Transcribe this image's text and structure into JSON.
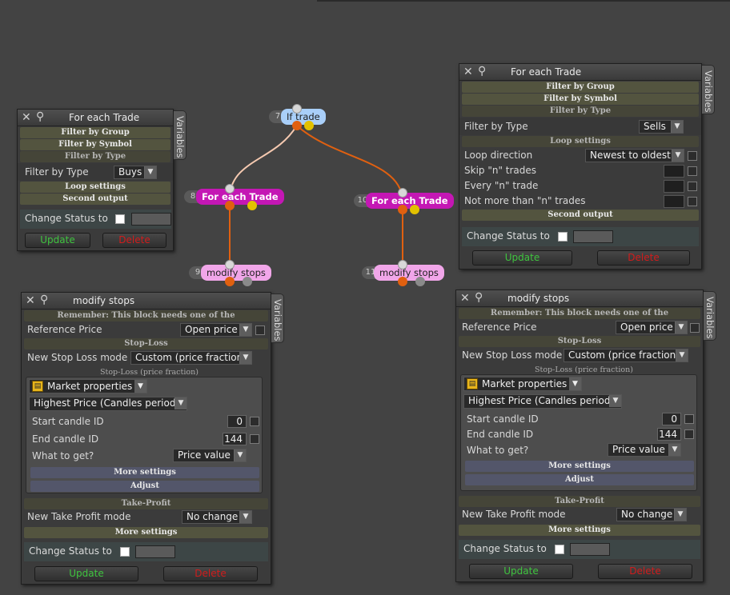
{
  "colors": {
    "background": "#434343",
    "wire_orange": "#e06010",
    "wire_light": "#f5c9b0",
    "node_magenta": "#c417b4",
    "node_pink": "#f1a6e9",
    "node_blue": "#a9cff9",
    "update_green": "#3fc43f",
    "delete_red": "#d11c1c"
  },
  "icons": {
    "close": "close-icon",
    "pin": "pin-icon",
    "dropdown": "chevron-down-icon",
    "market": "market-properties-icon"
  },
  "graph": {
    "nodes": [
      {
        "num": "7",
        "label": "If trade"
      },
      {
        "num": "8",
        "label": "For each Trade"
      },
      {
        "num": "10",
        "label": "For each Trade"
      },
      {
        "num": "9",
        "label": "modify stops"
      },
      {
        "num": "11",
        "label": "modify stops"
      }
    ]
  },
  "panel_left_trade": {
    "title": "For each Trade",
    "variables_tab": "Variables",
    "filter_group": "Filter by Group",
    "filter_symbol": "Filter by Symbol",
    "filter_type_header": "Filter by Type",
    "filter_type_label": "Filter by Type",
    "filter_type_value": "Buys",
    "loop_settings": "Loop settings",
    "second_output": "Second output",
    "change_status": "Change Status to",
    "update": "Update",
    "delete": "Delete"
  },
  "panel_right_trade": {
    "title": "For each Trade",
    "variables_tab": "Variables",
    "filter_group": "Filter by Group",
    "filter_symbol": "Filter by Symbol",
    "filter_type_header": "Filter by Type",
    "filter_type_label": "Filter by Type",
    "filter_type_value": "Sells",
    "loop_settings": "Loop settings",
    "loop_direction_label": "Loop direction",
    "loop_direction_value": "Newest to oldest",
    "skip_label": "Skip \"n\" trades",
    "every_label": "Every \"n\" trade",
    "not_more_label": "Not more than \"n\" trades",
    "second_output": "Second output",
    "change_status": "Change Status to",
    "update": "Update",
    "delete": "Delete"
  },
  "panel_left_stops": {
    "title": "modify stops",
    "variables_tab": "Variables",
    "remember": "Remember: This block needs one of the",
    "reference_price_label": "Reference Price",
    "reference_price_value": "Open price",
    "stop_loss": "Stop-Loss",
    "sl_mode_label": "New Stop Loss mode",
    "sl_mode_value": "Custom (price fraction)",
    "sl_sub": "Stop-Loss (price fraction)",
    "market_props": "Market properties",
    "highest_price": "Highest Price (Candles period)",
    "start_candle_label": "Start candle ID",
    "start_candle_value": "0",
    "end_candle_label": "End candle ID",
    "end_candle_value": "144",
    "what_to_get_label": "What to get?",
    "what_to_get_value": "Price value",
    "more_settings": "More settings",
    "adjust": "Adjust",
    "take_profit": "Take-Profit",
    "tp_mode_label": "New Take Profit mode",
    "tp_mode_value": "No change",
    "more_settings_2": "More settings",
    "change_status": "Change Status to",
    "update": "Update",
    "delete": "Delete"
  },
  "panel_right_stops": {
    "title": "modify stops",
    "variables_tab": "Variables",
    "remember": "Remember: This block needs one of the",
    "reference_price_label": "Reference Price",
    "reference_price_value": "Open price",
    "stop_loss": "Stop-Loss",
    "sl_mode_label": "New Stop Loss mode",
    "sl_mode_value": "Custom (price fraction)",
    "sl_sub": "Stop-Loss (price fraction)",
    "market_props": "Market properties",
    "highest_price": "Highest Price (Candles period)",
    "start_candle_label": "Start candle ID",
    "start_candle_value": "0",
    "end_candle_label": "End candle ID",
    "end_candle_value": "144",
    "what_to_get_label": "What to get?",
    "what_to_get_value": "Price value",
    "more_settings": "More settings",
    "adjust": "Adjust",
    "take_profit": "Take-Profit",
    "tp_mode_label": "New Take Profit mode",
    "tp_mode_value": "No change",
    "more_settings_2": "More settings",
    "change_status": "Change Status to",
    "update": "Update",
    "delete": "Delete"
  }
}
